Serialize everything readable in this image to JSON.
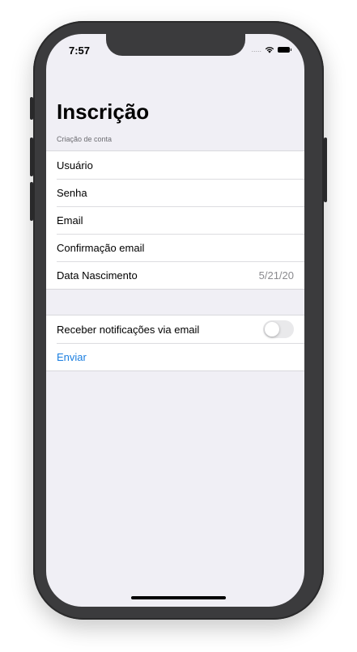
{
  "status_bar": {
    "time": "7:57",
    "signal_dots": "....."
  },
  "page": {
    "title": "Inscrição"
  },
  "form": {
    "section_header": "Criação de conta",
    "fields": [
      {
        "label": "Usuário",
        "value": ""
      },
      {
        "label": "Senha",
        "value": ""
      },
      {
        "label": "Email",
        "value": ""
      },
      {
        "label": "Confirmação email",
        "value": ""
      },
      {
        "label": "Data Nascimento",
        "value": "5/21/20"
      }
    ]
  },
  "actions": {
    "notifications_label": "Receber notificações via email",
    "notifications_on": false,
    "submit_label": "Enviar"
  },
  "colors": {
    "background": "#f0eff5",
    "accent": "#1a7ee0",
    "toggle_off": "#e9e9eb"
  }
}
